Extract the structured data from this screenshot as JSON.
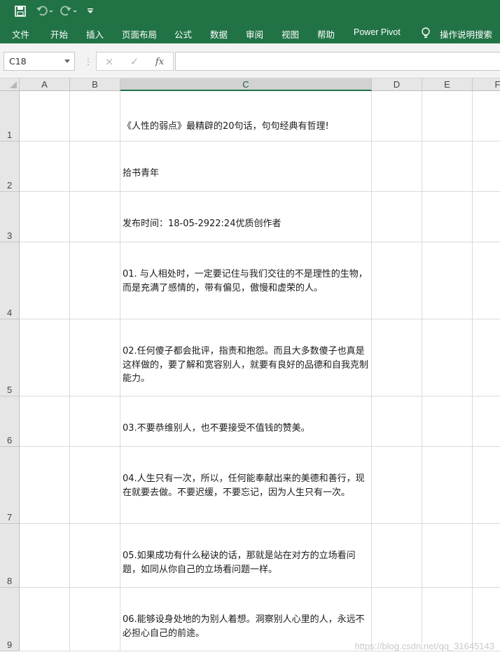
{
  "quick_access": {
    "save_icon": "save-icon",
    "undo_icon": "undo-icon",
    "redo_icon": "redo-icon",
    "customize_icon": "customize-qat-icon"
  },
  "ribbon": {
    "tabs": [
      "文件",
      "开始",
      "插入",
      "页面布局",
      "公式",
      "数据",
      "审阅",
      "视图",
      "帮助",
      "Power Pivot"
    ],
    "tell_me": "操作说明搜索",
    "accent_color": "#217346"
  },
  "formula_bar": {
    "name_box": "C18",
    "cancel_icon": "×",
    "enter_icon": "✓",
    "fx_label": "fx",
    "formula": ""
  },
  "grid": {
    "columns": [
      "A",
      "B",
      "C",
      "D",
      "E",
      "F"
    ],
    "active_column": "C",
    "rows": [
      {
        "n": "1",
        "c": "《人性的弱点》最精辟的20句话，句句经典有哲理!"
      },
      {
        "n": "2",
        "c": "拾书青年"
      },
      {
        "n": "3",
        "c": "发布时间：18-05-2922:24优质创作者"
      },
      {
        "n": "4",
        "c": "01. 与人相处时，一定要记住与我们交往的不是理性的生物，而是充满了感情的，带有偏见，傲慢和虚荣的人。"
      },
      {
        "n": "5",
        "c": "02.任何傻子都会批评，指责和抱怨。而且大多数傻子也真是这样做的，要了解和宽容别人，就要有良好的品德和自我克制能力。"
      },
      {
        "n": "6",
        "c": "03.不要恭维别人，也不要接受不值钱的赞美。"
      },
      {
        "n": "7",
        "c": "04.人生只有一次，所以，任何能奉献出来的美德和善行，现在就要去做。不要迟缓，不要忘记，因为人生只有一次。"
      },
      {
        "n": "8",
        "c": "05.如果成功有什么秘诀的话，那就是站在对方的立场看问题，如同从你自己的立场看问题一样。"
      },
      {
        "n": "9",
        "c": "06.能够设身处地的为别人着想。洞察别人心里的人，永远不必担心自己的前途。"
      }
    ]
  },
  "watermark": "https://blog.csdn.net/qq_31645143"
}
